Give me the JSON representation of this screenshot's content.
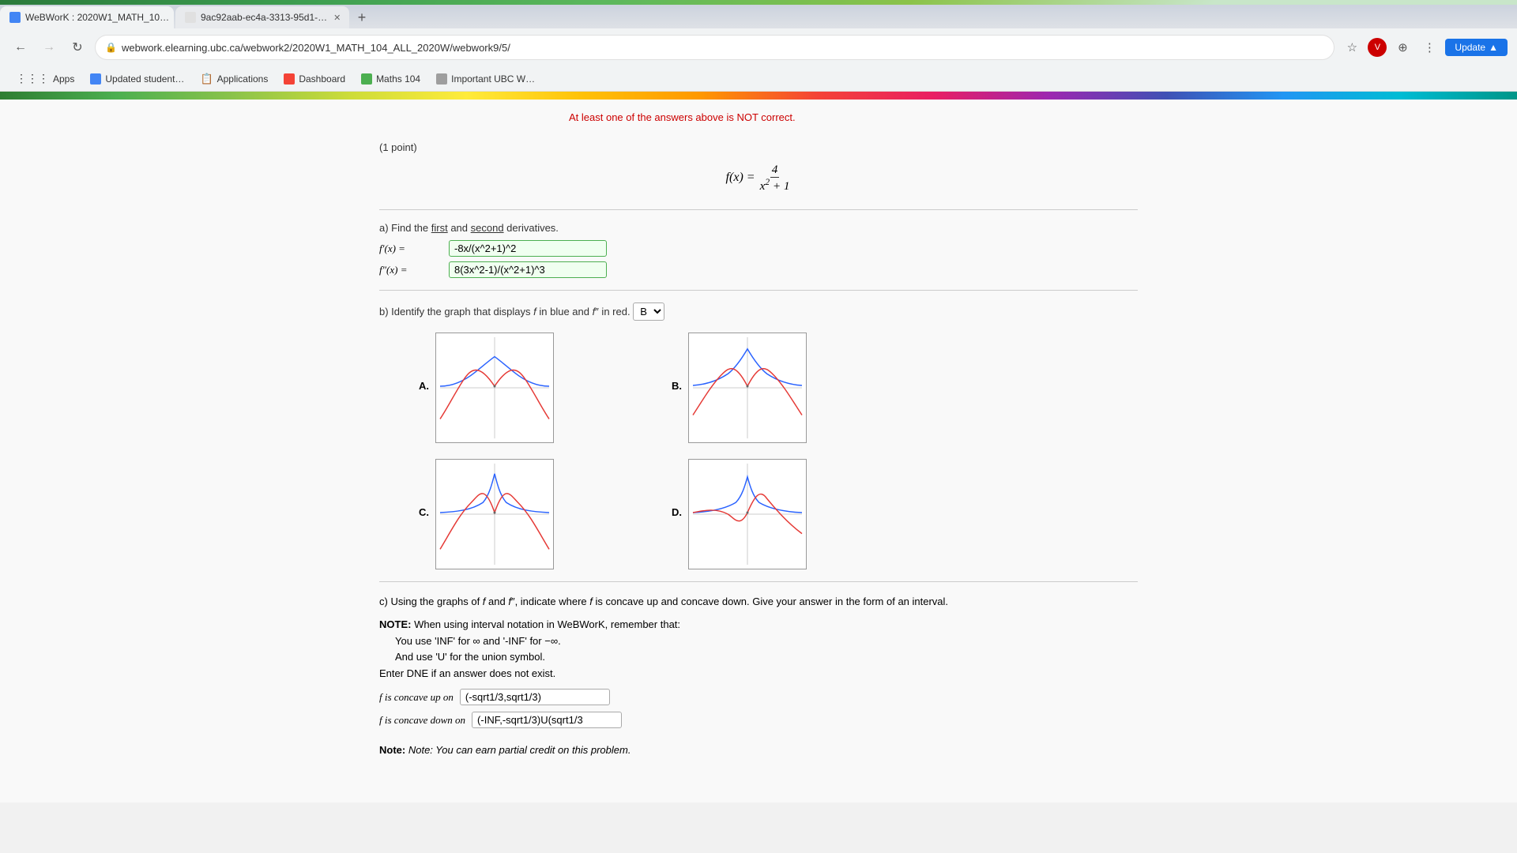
{
  "browser": {
    "tabs": [
      {
        "id": "tab1",
        "label": "WeBWorK : 2020W1_MATH_10…",
        "active": true,
        "favicon_color": "#4285f4"
      },
      {
        "id": "tab2",
        "label": "9ac92aab-ec4a-3313-95d1-…",
        "active": false,
        "favicon_color": "#e0e0e0"
      }
    ],
    "new_tab_label": "+",
    "url": "webwork.elearning.ubc.ca/webwork2/2020W1_MATH_104_ALL_2020W/webwork9/5/",
    "back_disabled": false,
    "forward_disabled": true,
    "update_button": "Update"
  },
  "bookmarks": [
    {
      "id": "apps",
      "label": "Apps",
      "type": "apps"
    },
    {
      "id": "bookmark1",
      "label": "Updated student…",
      "color": "#4285f4"
    },
    {
      "id": "bookmark2",
      "label": "Applications",
      "color": "#9e9e9e"
    },
    {
      "id": "bookmark3",
      "label": "Dashboard",
      "color": "#f44336"
    },
    {
      "id": "bookmark4",
      "label": "Maths 104",
      "color": "#4caf50"
    },
    {
      "id": "bookmark5",
      "label": "Important UBC W…",
      "color": "#9e9e9e"
    }
  ],
  "page": {
    "error_notice": "At least one of the answers above is NOT correct.",
    "point_label": "(1 point)",
    "function_display": "f(x) = 4 / (x² + 1)",
    "part_a": {
      "label": "a) Find the first and second derivatives.",
      "f_prime_label": "f′(x) =",
      "f_prime_value": "-8x/(x^2+1)^2",
      "f_double_prime_label": "f″(x) =",
      "f_double_prime_value": "8(3x^2-1)/(x^2+1)^3"
    },
    "part_b": {
      "label": "b) Identify the graph that displays",
      "f_label": "f",
      "in_blue": "in blue and",
      "f_double_prime_label": "f″",
      "in_red": "in red.",
      "selected_answer": "B",
      "dropdown_options": [
        "A",
        "B",
        "C",
        "D"
      ],
      "graphs": [
        {
          "id": "A",
          "label": "A."
        },
        {
          "id": "B",
          "label": "B."
        },
        {
          "id": "C",
          "label": "C."
        },
        {
          "id": "D",
          "label": "D."
        }
      ]
    },
    "part_c": {
      "label": "c) Using the graphs of",
      "f_label": "f",
      "and_label": "and",
      "f_double_prime_label": "f″",
      "indicate_label": ", indicate where",
      "f_label2": "f",
      "concave_text": "is concave up and concave down. Give your answer in the form of an interval.",
      "note_bold": "NOTE:",
      "note_text": " When using interval notation in WeBWorK, remember that:",
      "inf_line": "You use 'INF' for ∞ and '-INF' for −∞.",
      "union_line": "And use 'U' for the union symbol.",
      "dne_line": "Enter DNE if an answer does not exist.",
      "concave_up_label": "f is concave up on",
      "concave_up_value": "(-sqrt1/3,sqrt1/3)",
      "concave_down_label": "f is concave down on",
      "concave_down_value": "(-INF,-sqrt1/3)U(sqrt1/3"
    },
    "footer_note": "Note: You can earn partial credit on this problem."
  }
}
